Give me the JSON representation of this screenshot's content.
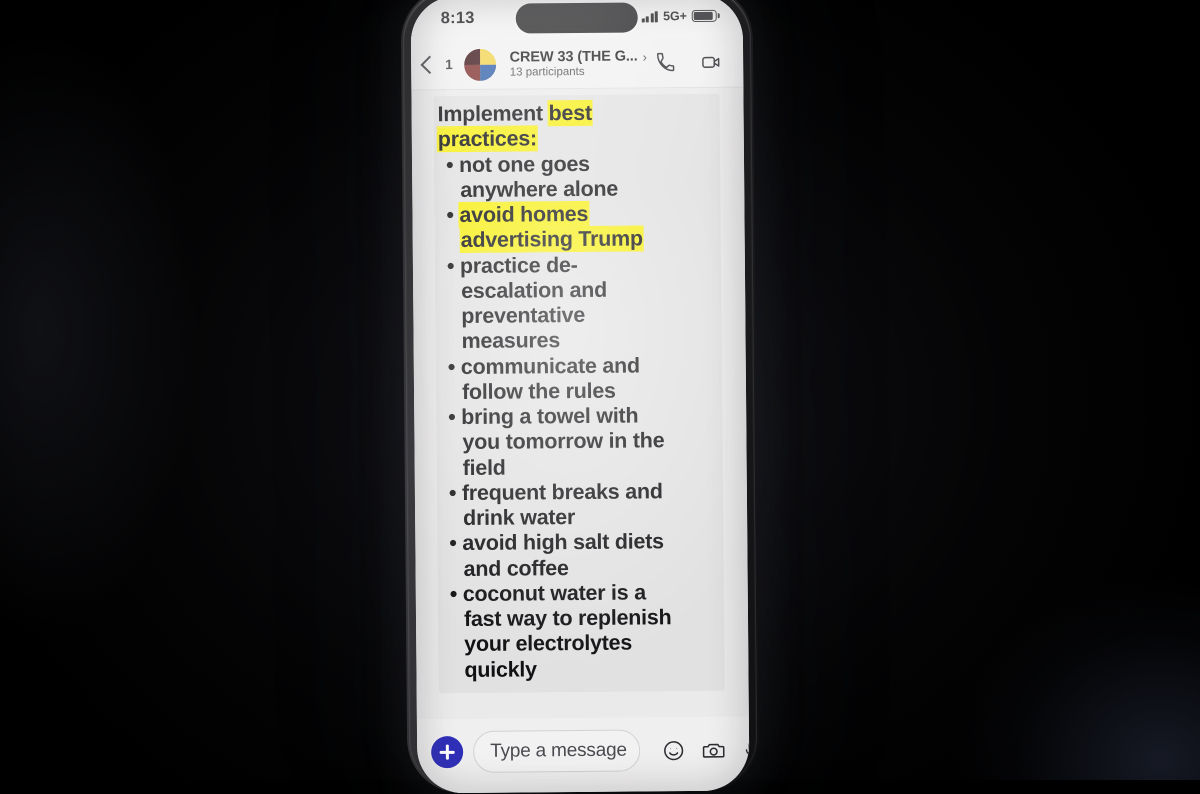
{
  "device": {
    "status_bar": {
      "clock": "8:13",
      "network_label": "5G+",
      "signal_icon": "signal-bars-icon",
      "battery_icon": "battery-icon"
    }
  },
  "chat_header": {
    "back_icon": "back-chevron-icon",
    "unread_count": "1",
    "avatar_icon": "group-avatar",
    "title": "CREW 33 (THE G...",
    "title_chevron": "›",
    "participants": "13 participants",
    "call_icon": "phone-call-icon",
    "video_icon": "video-camera-icon"
  },
  "message": {
    "lines": [
      {
        "type": "heading",
        "segments": [
          {
            "text": "Implement ",
            "highlight": false
          },
          {
            "text": "best",
            "highlight": true
          }
        ]
      },
      {
        "type": "heading",
        "segments": [
          {
            "text": "practices:",
            "highlight": true
          }
        ]
      },
      {
        "type": "bullet",
        "segments": [
          {
            "text": "• not one goes",
            "highlight": false
          }
        ]
      },
      {
        "type": "cont",
        "segments": [
          {
            "text": "anywhere alone",
            "highlight": false
          }
        ]
      },
      {
        "type": "bullet",
        "segments": [
          {
            "text": "• ",
            "highlight": false
          },
          {
            "text": "avoid homes",
            "highlight": true
          }
        ]
      },
      {
        "type": "cont",
        "segments": [
          {
            "text": "advertising Trump",
            "highlight": true
          }
        ]
      },
      {
        "type": "bullet",
        "segments": [
          {
            "text": "• practice de-",
            "highlight": false
          }
        ]
      },
      {
        "type": "cont",
        "segments": [
          {
            "text": "escalation and",
            "highlight": false
          }
        ]
      },
      {
        "type": "cont",
        "segments": [
          {
            "text": "preventative",
            "highlight": false
          }
        ]
      },
      {
        "type": "cont",
        "segments": [
          {
            "text": "measures",
            "highlight": false
          }
        ]
      },
      {
        "type": "bullet",
        "segments": [
          {
            "text": "• communicate and",
            "highlight": false
          }
        ]
      },
      {
        "type": "cont",
        "segments": [
          {
            "text": "follow the rules",
            "highlight": false
          }
        ]
      },
      {
        "type": "bullet",
        "segments": [
          {
            "text": "• bring a towel with",
            "highlight": false
          }
        ]
      },
      {
        "type": "cont",
        "segments": [
          {
            "text": "you tomorrow in the",
            "highlight": false
          }
        ]
      },
      {
        "type": "cont",
        "segments": [
          {
            "text": "field",
            "highlight": false
          }
        ]
      },
      {
        "type": "bullet",
        "segments": [
          {
            "text": "• frequent breaks and",
            "highlight": false
          }
        ]
      },
      {
        "type": "cont",
        "segments": [
          {
            "text": "drink water",
            "highlight": false
          }
        ]
      },
      {
        "type": "bullet",
        "segments": [
          {
            "text": "• avoid high salt diets",
            "highlight": false
          }
        ]
      },
      {
        "type": "cont",
        "segments": [
          {
            "text": "and coffee",
            "highlight": false
          }
        ]
      },
      {
        "type": "bullet",
        "segments": [
          {
            "text": "• coconut water is a",
            "highlight": false
          }
        ]
      },
      {
        "type": "cont",
        "segments": [
          {
            "text": "fast way to replenish",
            "highlight": false
          }
        ]
      },
      {
        "type": "cont",
        "segments": [
          {
            "text": "your electrolytes",
            "highlight": false
          }
        ]
      },
      {
        "type": "cont",
        "segments": [
          {
            "text": "quickly",
            "highlight": false
          }
        ]
      }
    ]
  },
  "composer": {
    "attach_icon": "plus-icon",
    "placeholder": "Type a message",
    "emoji_icon": "smiley-face-icon",
    "camera_icon": "camera-icon",
    "mic_icon": "microphone-icon"
  },
  "colors": {
    "highlight_yellow": "#f7ef16",
    "accent_blue": "#2f2fb8",
    "background": "#000000",
    "screen": "#ebeaea"
  }
}
